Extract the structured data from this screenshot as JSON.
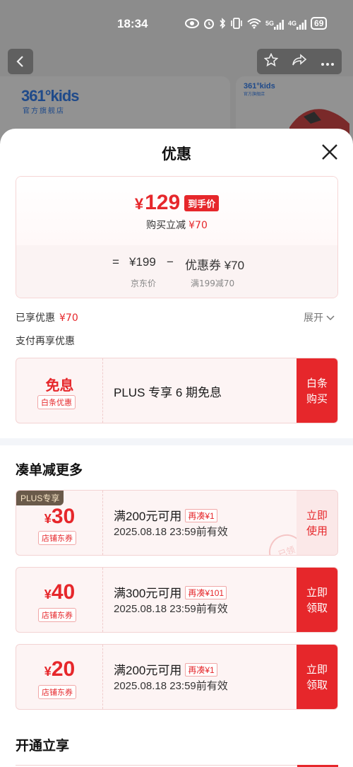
{
  "status_bar": {
    "time": "18:34",
    "battery": "69",
    "icons": [
      "eye-icon",
      "alarm-icon",
      "bluetooth-icon",
      "vibrate-icon",
      "wifi-icon",
      "signal-5g-icon",
      "signal-4g-icon"
    ],
    "network_5g": "5G",
    "network_4g": "4G"
  },
  "background_page": {
    "brand_logo": "361°kids",
    "brand_sub": "官方旗舰店"
  },
  "sheet": {
    "title": "优惠",
    "price_box": {
      "final_price_symbol": "¥",
      "final_price": "129",
      "final_badge": "到手价",
      "discount_label": "购买立减",
      "discount_value": "¥70",
      "calc": {
        "equals": "=",
        "jd_price": "¥199",
        "minus": "−",
        "coupon_price": "优惠券 ¥70",
        "jd_label": "京东价",
        "coupon_rule": "满199减70"
      }
    },
    "enjoyed_label": "已享优惠",
    "enjoyed_value": "¥70",
    "expand_label": "展开",
    "pay_more_label": "支付再享优惠",
    "baitiao_card": {
      "title": "免息",
      "tag": "白条优惠",
      "desc": "PLUS 专享 6 期免息",
      "action": "白条购买"
    },
    "section_more": "凑单减更多",
    "coupons": [
      {
        "plus_label": "PLUS专享",
        "symbol": "¥",
        "amount": "30",
        "tag": "店铺东券",
        "condition": "满200元可用",
        "gap_tag": "再凑¥1",
        "expiry": "2025.08.18 23:59前有效",
        "action_line1": "立即",
        "action_line2": "使用",
        "stamp": "已领"
      },
      {
        "symbol": "¥",
        "amount": "40",
        "tag": "店铺东券",
        "condition": "满300元可用",
        "gap_tag": "再凑¥101",
        "expiry": "2025.08.18 23:59前有效",
        "action_line1": "立即",
        "action_line2": "领取"
      },
      {
        "symbol": "¥",
        "amount": "20",
        "tag": "店铺东券",
        "condition": "满200元可用",
        "gap_tag": "再凑¥1",
        "expiry": "2025.08.18 23:59前有效",
        "action_line1": "立即",
        "action_line2": "领取"
      }
    ],
    "section_open": "开通立享"
  },
  "colors": {
    "accent_red": "#e6272b",
    "card_bg": "#fdf4f4",
    "plus_label_bg": "#6a5a4a"
  }
}
